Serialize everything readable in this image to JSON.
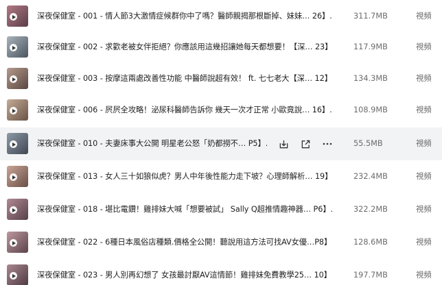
{
  "files": [
    {
      "name": "深夜保健室 - 001 - 情人節3大激情症候群你中了嗎？醫師親揭那根斷掉、妹妹… 26】.mp4",
      "size": "311.7MB",
      "type": "視頻",
      "thumb_color": "#8a5a6a",
      "thumb_icon": "play-icon"
    },
    {
      "name": "深夜保健室 - 002 - 求歡老被女伴拒絕？你應該用這幾招讓她每天都想要！【深… 23】.mp4",
      "size": "117.9MB",
      "type": "視頻",
      "thumb_color": "#6f7b86",
      "thumb_icon": "play-icon"
    },
    {
      "name": "深夜保健室 - 003 - 按摩這兩處改善性功能 中醫師說超有效！ ft. 七七老大【深… 12】.mp4",
      "size": "134.3MB",
      "type": "視頻",
      "thumb_color": "#7d6a63",
      "thumb_icon": "play-icon"
    },
    {
      "name": "深夜保健室 - 006 - 屄屄全攻略！泌尿科醫師告訴你 幾天一次才正常 小歐竟說… 16】.mp4",
      "size": "108.9MB",
      "type": "視頻",
      "thumb_color": "#8a7667",
      "thumb_icon": "play-icon"
    },
    {
      "name": "深夜保健室 - 010 - 夫妻床事大公開 明星老公怒「奶都撈不… P5】.mp4",
      "size": "55.5MB",
      "type": "視頻",
      "thumb_color": "#5e6a78",
      "thumb_icon": "play-icon"
    },
    {
      "name": "深夜保健室 - 013 - 女人三十如狼似虎？男人中年後性能力走下坡？心理師解析… 19】.mp4",
      "size": "232.4MB",
      "type": "視頻",
      "thumb_color": "#93786e",
      "thumb_icon": "play-icon"
    },
    {
      "name": "深夜保健室 - 018 - 堪比電鑽！雞排妹大喊「想要被試」 Sally Q超推情趣神器… P6】.mp4",
      "size": "322.2MB",
      "type": "視頻",
      "thumb_color": "#7a5f66",
      "thumb_icon": "play-icon"
    },
    {
      "name": "深夜保健室 - 022 - 6種日本風俗店種類.價格全公開！聽說用這方法可找AV女優…P8】.mp4",
      "size": "128.6MB",
      "type": "視頻",
      "thumb_color": "#866a70",
      "thumb_icon": "play-icon"
    },
    {
      "name": "深夜保健室 - 023 - 男人別再幻想了 女孩最討厭AV這情節！雞排妹免費教學25… 10】.mp4",
      "size": "197.7MB",
      "type": "視頻",
      "thumb_color": "#745c62",
      "thumb_icon": "play-icon"
    }
  ],
  "hovered_row": {
    "index": 4,
    "actions": [
      {
        "icon": "download-icon"
      },
      {
        "icon": "share-icon"
      },
      {
        "icon": "more-icon"
      }
    ]
  }
}
